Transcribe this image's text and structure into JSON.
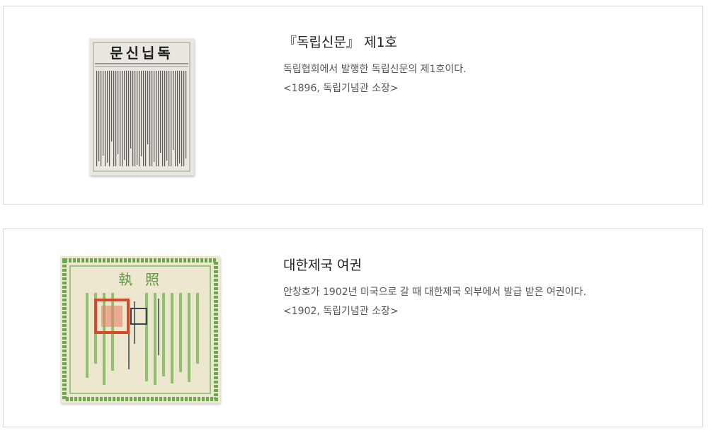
{
  "items": [
    {
      "title": "『독립신문』 제1호",
      "description": "독립협회에서 발행한 독립신문의 제1호이다.",
      "caption": "<1896, 독립기념관 소장>",
      "image_title_text": "문신닙독"
    },
    {
      "title": "대한제국 여권",
      "description": "안창호가 1902년 미국으로 갈 때 대한제국 외부에서 발급 받은 여권이다.",
      "caption": "<1902, 독립기념관 소장>",
      "image_title_text": "執照"
    }
  ],
  "colors": {
    "border": "#d9d9d9",
    "passport_green": "#6aa84f",
    "seal_red": "#d9482b"
  }
}
